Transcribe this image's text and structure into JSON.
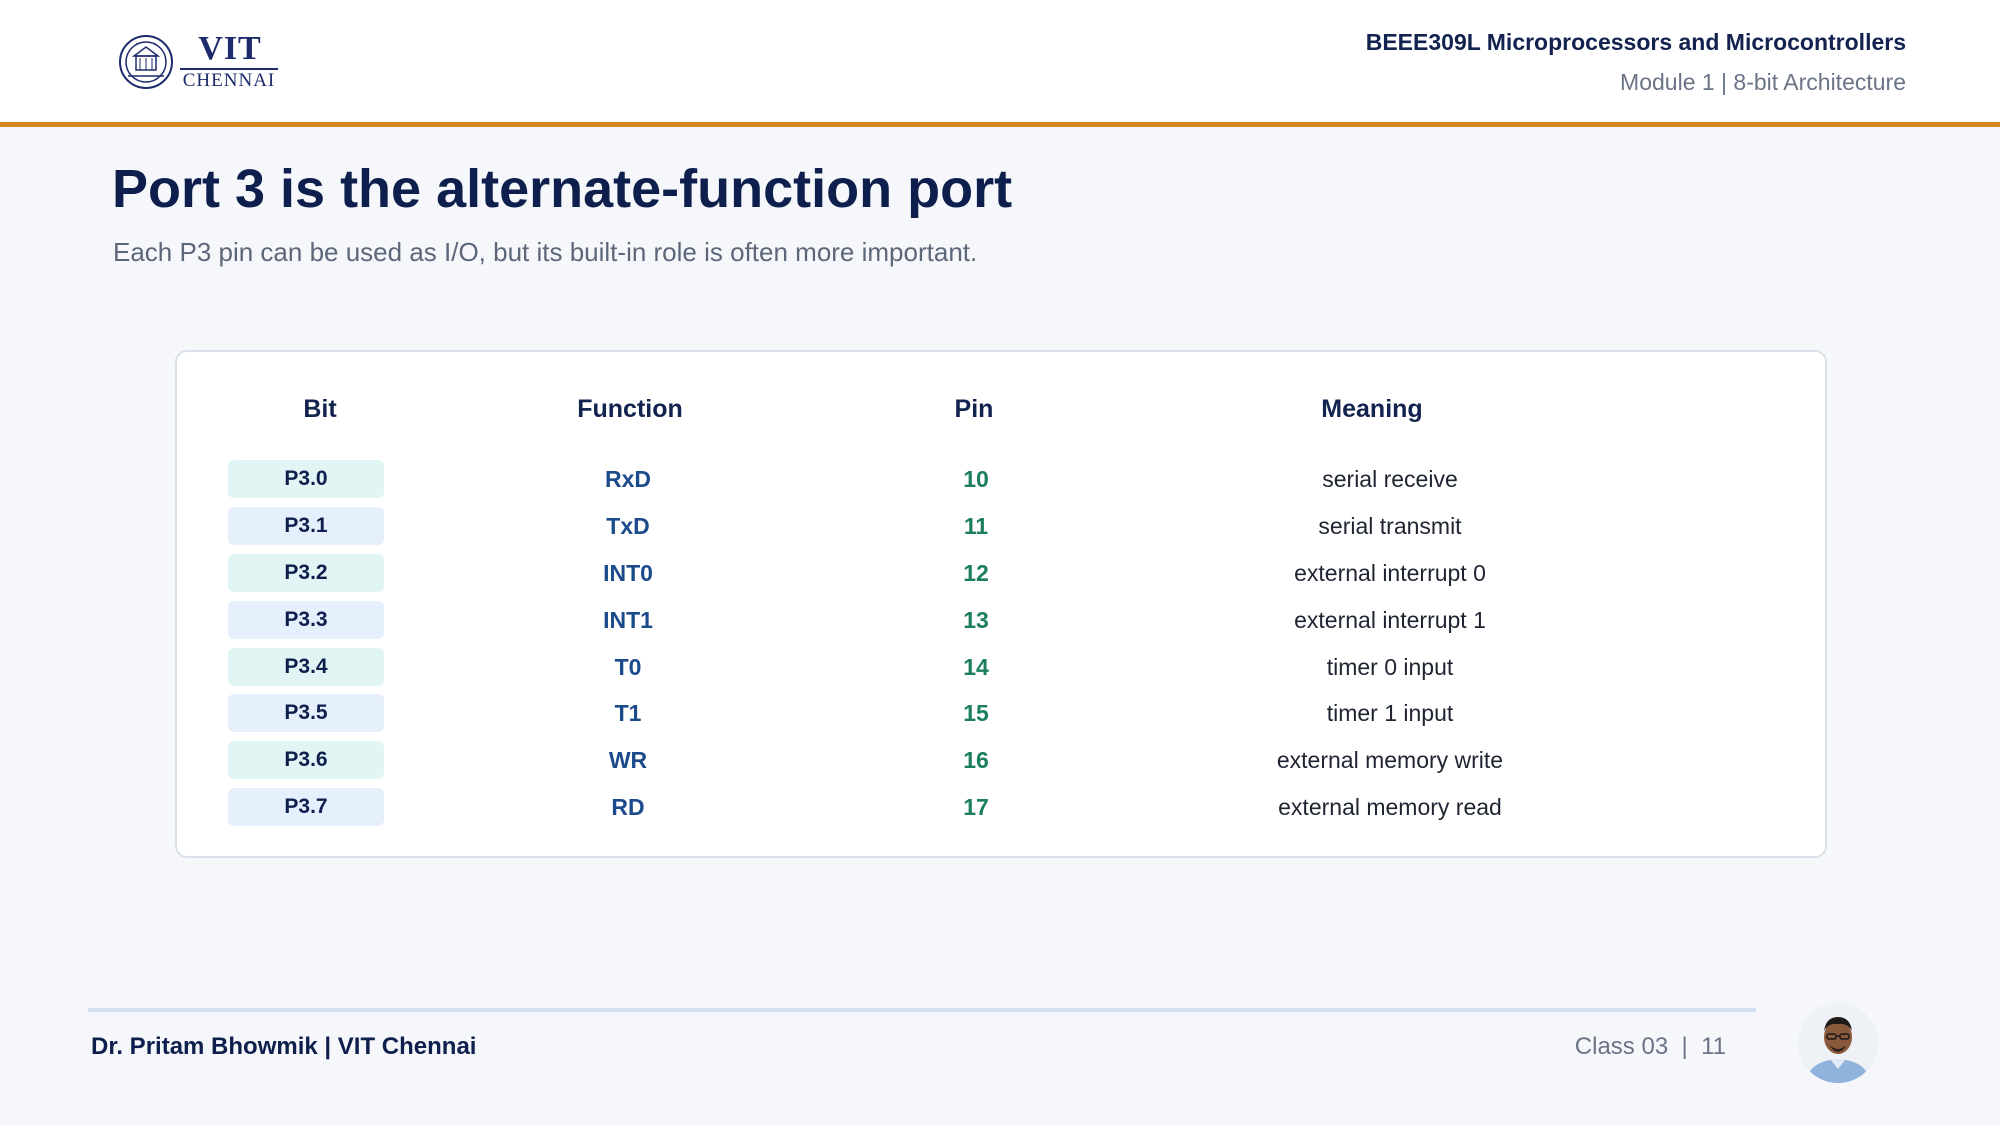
{
  "header": {
    "logo": {
      "text_main": "VIT",
      "text_sub": "CHENNAI"
    },
    "course_title": "BEEE309L Microprocessors and Microcontrollers",
    "module": "Module 1 | 8-bit Architecture"
  },
  "slide": {
    "title": "Port 3 is the alternate-function port",
    "subtitle": "Each P3 pin can be used as I/O, but its built-in role is often more important."
  },
  "table": {
    "headers": {
      "bit": "Bit",
      "function": "Function",
      "pin": "Pin",
      "meaning": "Meaning"
    },
    "rows": [
      {
        "bit": "P3.0",
        "function": "RxD",
        "pin": "10",
        "meaning": "serial receive"
      },
      {
        "bit": "P3.1",
        "function": "TxD",
        "pin": "11",
        "meaning": "serial transmit"
      },
      {
        "bit": "P3.2",
        "function": "INT0",
        "pin": "12",
        "meaning": "external interrupt 0"
      },
      {
        "bit": "P3.3",
        "function": "INT1",
        "pin": "13",
        "meaning": "external interrupt 1"
      },
      {
        "bit": "P3.4",
        "function": "T0",
        "pin": "14",
        "meaning": "timer 0 input"
      },
      {
        "bit": "P3.5",
        "function": "T1",
        "pin": "15",
        "meaning": "timer 1 input"
      },
      {
        "bit": "P3.6",
        "function": "WR",
        "pin": "16",
        "meaning": "external memory write"
      },
      {
        "bit": "P3.7",
        "function": "RD",
        "pin": "17",
        "meaning": "external memory read"
      }
    ]
  },
  "footer": {
    "author": "Dr. Pritam Bhowmik | VIT Chennai",
    "page": "Class 03  |  11"
  },
  "colors": {
    "accent_bar": "#d4861f",
    "title": "#0e1f4d",
    "function_text": "#1c4b8c",
    "pin_text": "#1b7f5a"
  }
}
